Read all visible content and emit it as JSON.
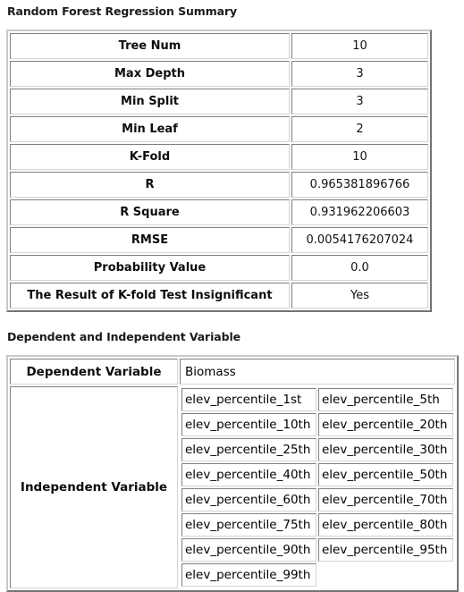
{
  "sections": {
    "summary": {
      "title": "Random Forest Regression Summary",
      "rows": [
        {
          "label": "Tree Num",
          "value": "10"
        },
        {
          "label": "Max Depth",
          "value": "3"
        },
        {
          "label": "Min Split",
          "value": "3"
        },
        {
          "label": "Min Leaf",
          "value": "2"
        },
        {
          "label": "K-Fold",
          "value": "10"
        },
        {
          "label": "R",
          "value": "0.965381896766"
        },
        {
          "label": "R Square",
          "value": "0.931962206603"
        },
        {
          "label": "RMSE",
          "value": "0.0054176207024"
        },
        {
          "label": "Probability Value",
          "value": "0.0"
        },
        {
          "label": "The Result of K-fold Test Insignificant",
          "value": "Yes"
        }
      ]
    },
    "variables": {
      "title": "Dependent and Independent Variable",
      "dependent_label": "Dependent Variable",
      "dependent_value": "Biomass",
      "independent_label": "Independent Variable",
      "independent_rows": [
        [
          "elev_percentile_1st",
          "elev_percentile_5th"
        ],
        [
          "elev_percentile_10th",
          "elev_percentile_20th"
        ],
        [
          "elev_percentile_25th",
          "elev_percentile_30th"
        ],
        [
          "elev_percentile_40th",
          "elev_percentile_50th"
        ],
        [
          "elev_percentile_60th",
          "elev_percentile_70th"
        ],
        [
          "elev_percentile_75th",
          "elev_percentile_80th"
        ],
        [
          "elev_percentile_90th",
          "elev_percentile_95th"
        ],
        [
          "elev_percentile_99th",
          ""
        ]
      ]
    }
  }
}
